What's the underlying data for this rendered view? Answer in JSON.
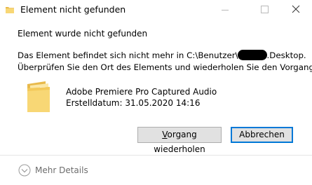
{
  "window": {
    "title": "Element nicht gefunden",
    "icon": "folder-icon",
    "controls": {
      "minimize": "minimize-icon",
      "maximize": "maximize-icon",
      "close": "close-icon"
    }
  },
  "dialog": {
    "heading": "Element wurde nicht gefunden",
    "message_line1_before": "Das Element befindet sich nicht mehr in C:\\Benutzer\\",
    "message_line1_after": ".Desktop.",
    "message_line2": "Überprüfen Sie den Ort des Elements und wiederholen Sie den Vorgang."
  },
  "file": {
    "icon": "folder-icon",
    "name": "Adobe Premiere Pro Captured Audio",
    "created": "Erstelldatum: 31.05.2020 14:16"
  },
  "buttons": {
    "retry_underlined": "V",
    "retry_rest": "organg wiederholen",
    "cancel": "Abbrechen"
  },
  "footer": {
    "more_details": "Mehr Details",
    "icon": "chevron-down-circle-icon"
  },
  "colors": {
    "accent": "#0078d7",
    "button_bg": "#e1e1e1",
    "folder_yellow": "#f8d775"
  }
}
